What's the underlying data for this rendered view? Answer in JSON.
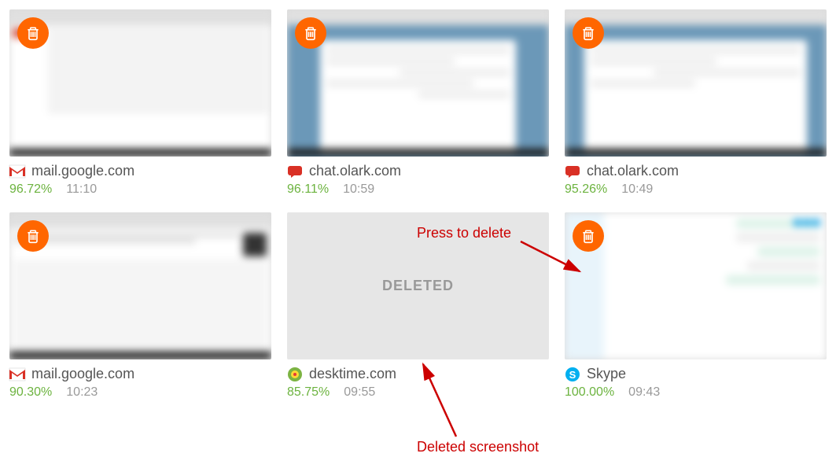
{
  "screenshots": [
    {
      "site": "mail.google.com",
      "percent": "96.72%",
      "time": "11:10",
      "icon": "gmail",
      "thumb": "gmail",
      "deleted": false
    },
    {
      "site": "chat.olark.com",
      "percent": "96.11%",
      "time": "10:59",
      "icon": "olark",
      "thumb": "olark",
      "deleted": false
    },
    {
      "site": "chat.olark.com",
      "percent": "95.26%",
      "time": "10:49",
      "icon": "olark",
      "thumb": "olark",
      "deleted": false
    },
    {
      "site": "mail.google.com",
      "percent": "90.30%",
      "time": "10:23",
      "icon": "gmail",
      "thumb": "gmail2",
      "deleted": false
    },
    {
      "site": "desktime.com",
      "percent": "85.75%",
      "time": "09:55",
      "icon": "desktime",
      "thumb": "deleted",
      "deleted": true
    },
    {
      "site": "Skype",
      "percent": "100.00%",
      "time": "09:43",
      "icon": "skype",
      "thumb": "skype",
      "deleted": false
    }
  ],
  "deleted_label": "DELETED",
  "annotations": {
    "press_to_delete": "Press to delete",
    "deleted_screenshot": "Deleted screenshot"
  },
  "colors": {
    "delete_btn": "#ff6600",
    "percent_green": "#6cb33f",
    "annotation": "#cc0000"
  }
}
